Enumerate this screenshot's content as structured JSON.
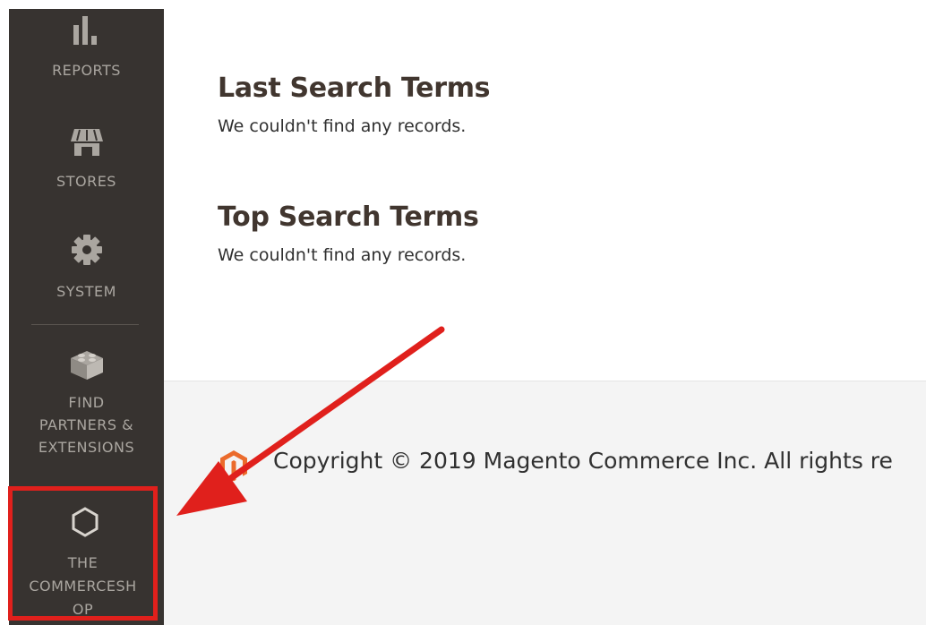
{
  "sidebar": {
    "items": [
      {
        "label": "REPORTS",
        "icon": "bar-chart-icon"
      },
      {
        "label": "STORES",
        "icon": "storefront-icon"
      },
      {
        "label": "SYSTEM",
        "icon": "gear-icon"
      },
      {
        "label_lines": [
          "FIND",
          "PARTNERS &",
          "EXTENSIONS"
        ],
        "icon": "lego-brick-icon"
      },
      {
        "label_lines": [
          "THE",
          "COMMERCESH",
          "OP"
        ],
        "icon": "hexagon-icon"
      }
    ]
  },
  "main": {
    "sections": [
      {
        "title": "Last Search Terms",
        "text": "We couldn't find any records."
      },
      {
        "title": "Top Search Terms",
        "text": "We couldn't find any records."
      }
    ]
  },
  "footer": {
    "copyright": "Copyright © 2019 Magento Commerce Inc. All rights re",
    "logo_icon": "magento-logo-icon"
  },
  "colors": {
    "sidebar_bg": "#373330",
    "sidebar_text": "#aaa6a0",
    "highlight_red": "#e0201c",
    "magento_orange": "#eb6b2c"
  }
}
